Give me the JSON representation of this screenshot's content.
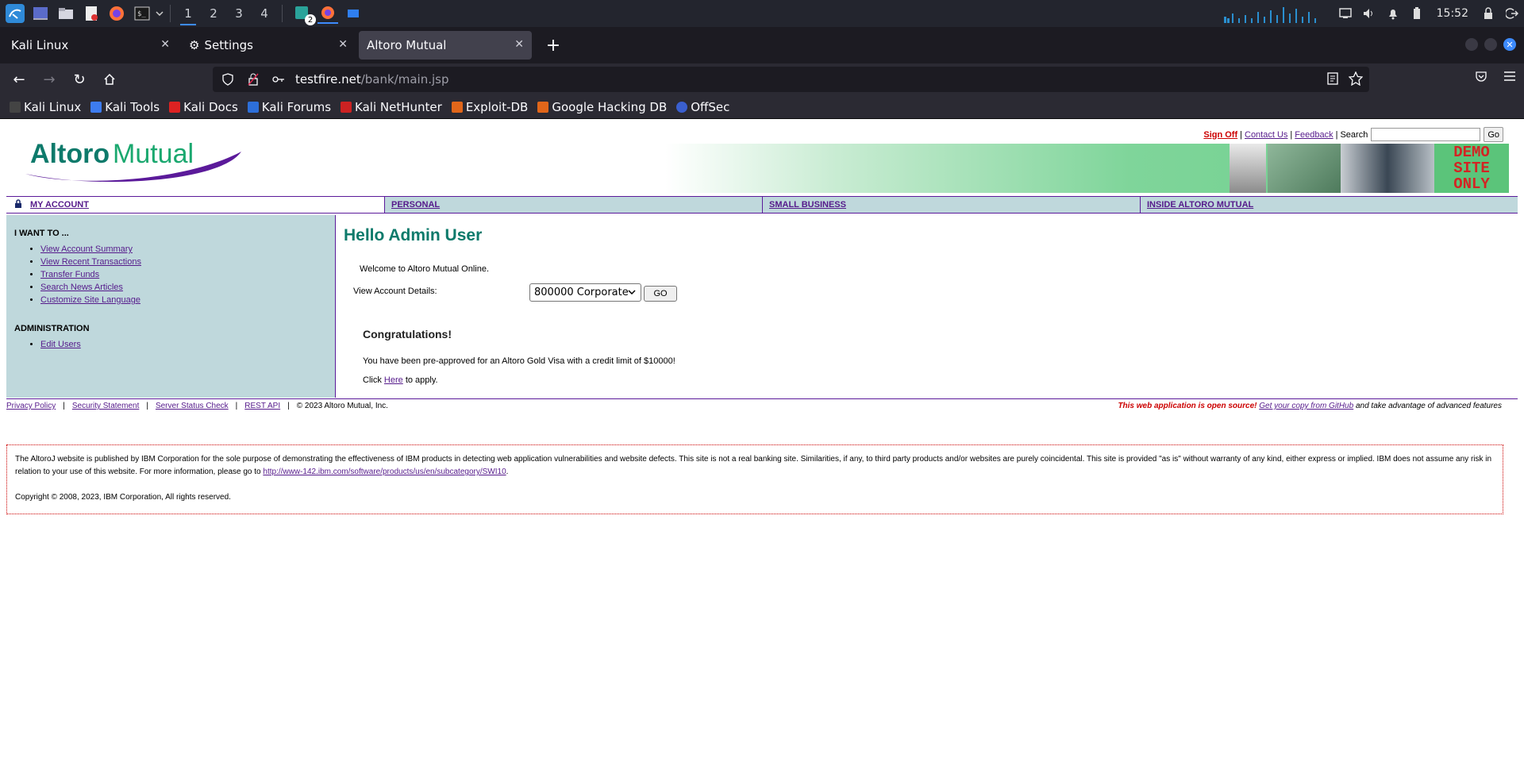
{
  "taskbar": {
    "workspaces": [
      "1",
      "2",
      "3",
      "4"
    ],
    "active_workspace": "1",
    "badge": "2",
    "clock": "15:52",
    "accent": "#3d8bfd"
  },
  "browser": {
    "tabs": [
      {
        "label": "Kali Linux"
      },
      {
        "label": "Settings"
      },
      {
        "label": "Altoro Mutual"
      }
    ],
    "active_tab": 2,
    "url_host": "testfire.net",
    "url_path": "/bank/main.jsp",
    "bookmarks": [
      "Kali Linux",
      "Kali Tools",
      "Kali Docs",
      "Kali Forums",
      "Kali NetHunter",
      "Exploit-DB",
      "Google Hacking DB",
      "OffSec"
    ]
  },
  "site": {
    "logo": {
      "part1": "Altoro",
      "part2": "Mutual"
    },
    "toplinks": {
      "signoff": "Sign Off",
      "sep": "|",
      "contact": "Contact Us",
      "feedback": "Feedback",
      "search_label": "Search",
      "go": "Go"
    },
    "demo": [
      "DEMO",
      "SITE",
      "ONLY"
    ],
    "nav": [
      "MY ACCOUNT",
      "PERSONAL",
      "SMALL BUSINESS",
      "INSIDE ALTORO MUTUAL"
    ],
    "sidebar": {
      "heading": "I WANT TO ...",
      "items": [
        "View Account Summary",
        "View Recent Transactions",
        "Transfer Funds",
        "Search News Articles",
        "Customize Site Language"
      ],
      "admin_heading": "ADMINISTRATION",
      "admin_items": [
        "Edit Users"
      ]
    },
    "main": {
      "greeting": "Hello Admin User",
      "welcome": "Welcome to Altoro Mutual Online.",
      "view_account_label": "View Account Details:",
      "selected_account": "800000 Corporate",
      "go_label": "GO",
      "congrats": "Congratulations!",
      "preapproved": "You have been pre-approved for an Altoro Gold Visa with a credit limit of $10000!",
      "apply_prefix": "Click",
      "apply_link": "Here",
      "apply_suffix": "to apply."
    },
    "footer": {
      "links": [
        "Privacy Policy",
        "Security Statement",
        "Server Status Check",
        "REST API"
      ],
      "sep": "|",
      "copyright": "© 2023 Altoro Mutual, Inc.",
      "open_source": "This web application is open source!",
      "github_link": "Get your copy from GitHub",
      "advanced": "and take advantage of advanced features"
    },
    "disclaimer": {
      "text": "The AltoroJ website is published by IBM Corporation for the sole purpose of demonstrating the effectiveness of IBM products in detecting web application vulnerabilities and website defects. This site is not a real banking site. Similarities, if any, to third party products and/or websites are purely coincidental. This site is provided \"as is\" without warranty of any kind, either express or implied. IBM does not assume any risk in relation to your use of this website. For more information, please go to",
      "link": "http://www-142.ibm.com/software/products/us/en/subcategory/SWI10",
      "period": ".",
      "copyright": "Copyright © 2008, 2023, IBM Corporation, All rights reserved."
    },
    "colors": {
      "purple": "#5b1a9a",
      "teal_heading": "#0d7a6b",
      "sidebar_bg": "#bfd8dc",
      "red": "#cc0000"
    }
  }
}
